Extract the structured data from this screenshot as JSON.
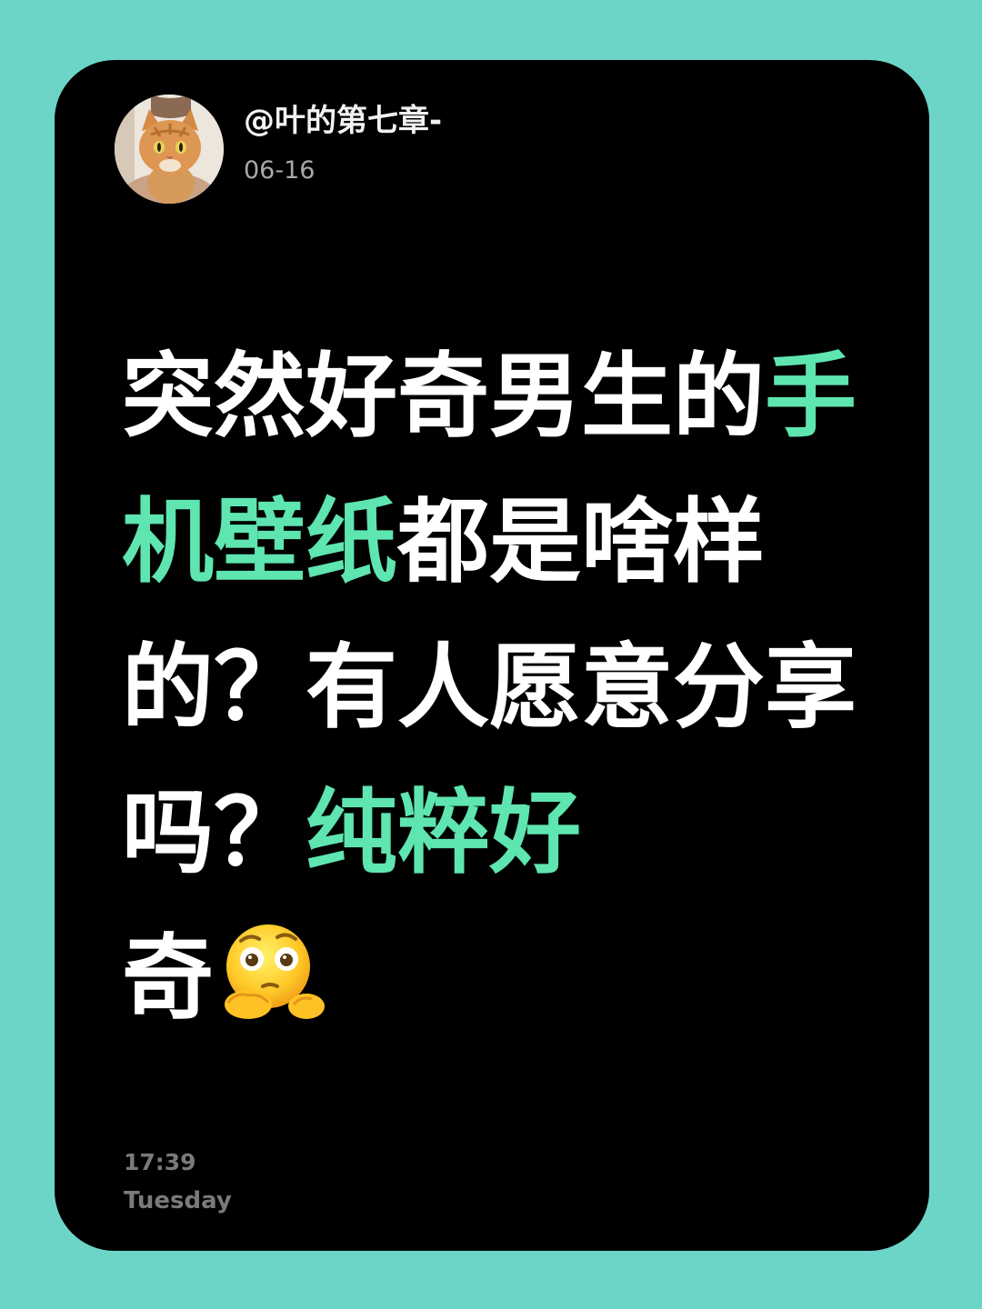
{
  "author": {
    "avatar_icon": "cat-photo-avatar",
    "username": "@叶的第七章-",
    "date": "06-16"
  },
  "post": {
    "headline_parts": [
      {
        "text": "突然好奇男生的",
        "highlight": false
      },
      {
        "text": "手机壁纸",
        "highlight": true
      },
      {
        "text": "都是啥样的？有人愿意分享吗？",
        "highlight": false
      },
      {
        "text": "纯粹好",
        "highlight": true
      },
      {
        "text": "奇",
        "highlight": false
      }
    ],
    "emoji_icon": "thinking-face-emoji"
  },
  "footer": {
    "time": "17:39",
    "day": "Tuesday"
  },
  "colors": {
    "background": "#6dd5c8",
    "card": "#000000",
    "text": "#ffffff",
    "highlight": "#5ee5b0",
    "muted": "#7a7a7a"
  }
}
